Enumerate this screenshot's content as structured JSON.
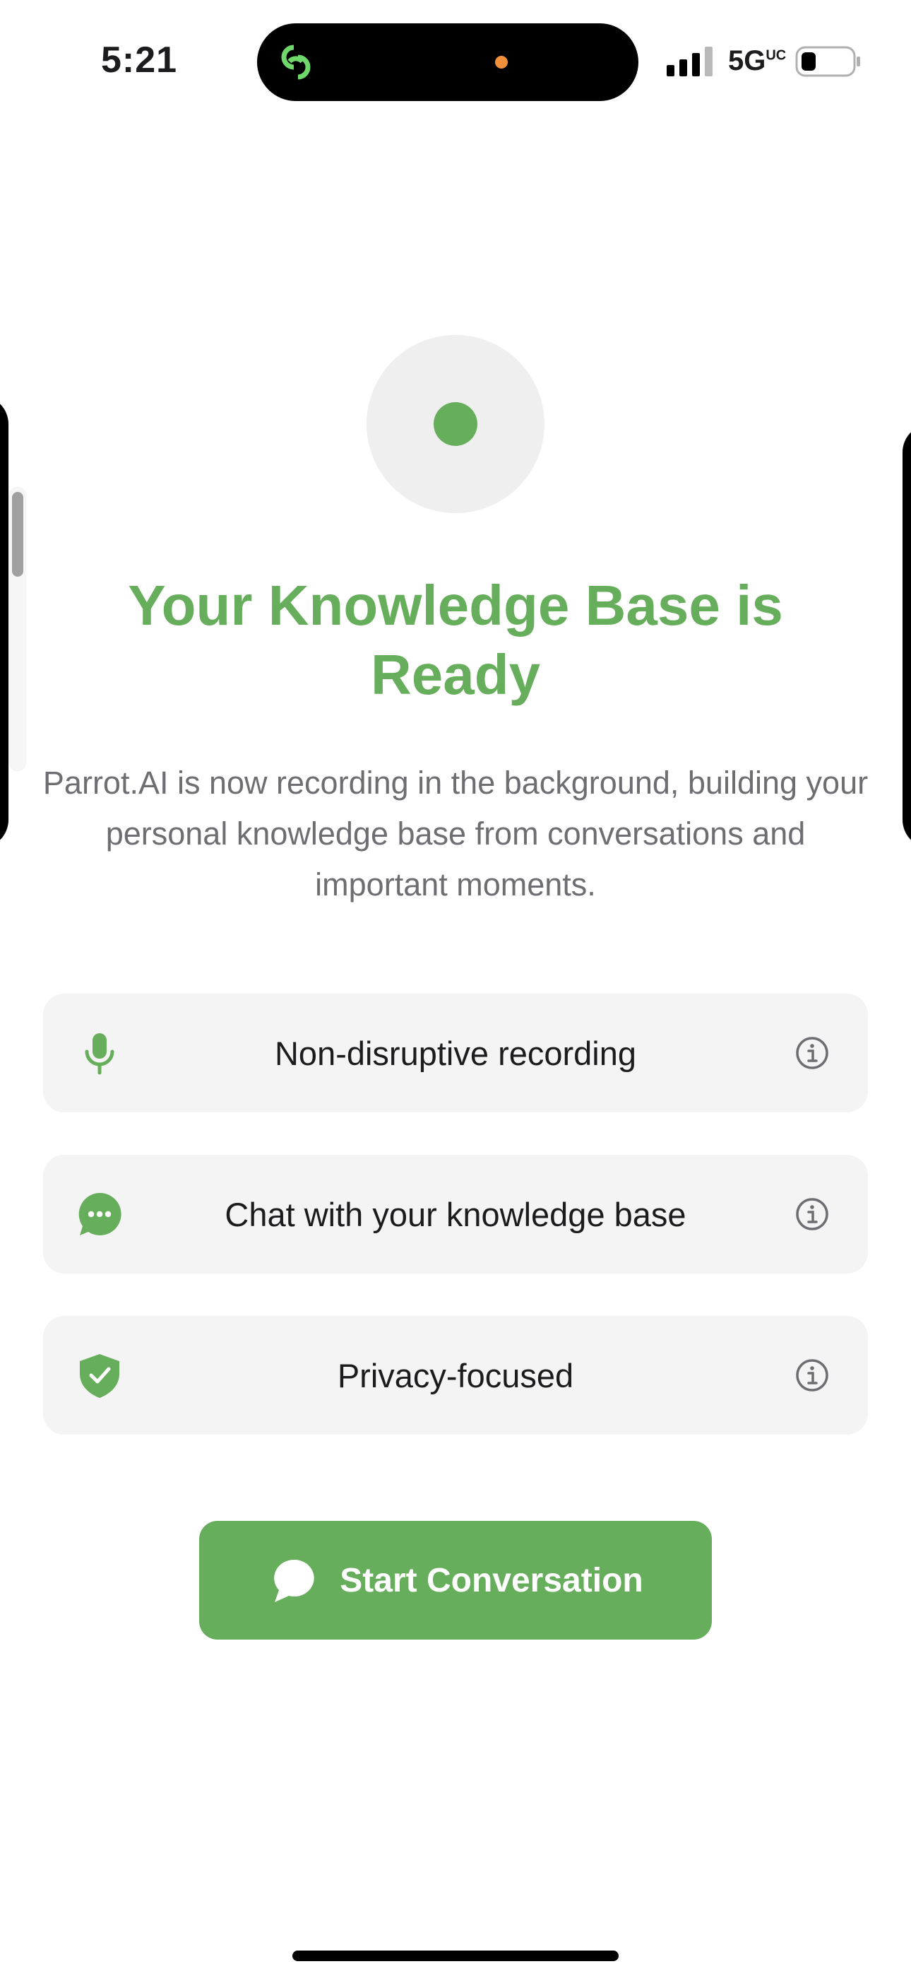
{
  "status_bar": {
    "time": "5:21",
    "network": "5G",
    "network_sup": "UC"
  },
  "hero": {
    "title": "Your Knowledge Base is Ready",
    "subtitle": "Parrot.AI is now recording in the background, building your personal knowledge base from conversations and important moments."
  },
  "features": [
    {
      "icon": "microphone-icon",
      "label": "Non-disruptive recording"
    },
    {
      "icon": "chat-bubble-icon",
      "label": "Chat with your knowledge base"
    },
    {
      "icon": "shield-check-icon",
      "label": "Privacy-focused"
    }
  ],
  "cta": {
    "label": "Start Conversation",
    "icon": "chat-bubble-icon"
  },
  "colors": {
    "accent": "#67ae5c",
    "card_bg": "#f4f4f4",
    "subtitle": "#6d6d72"
  }
}
